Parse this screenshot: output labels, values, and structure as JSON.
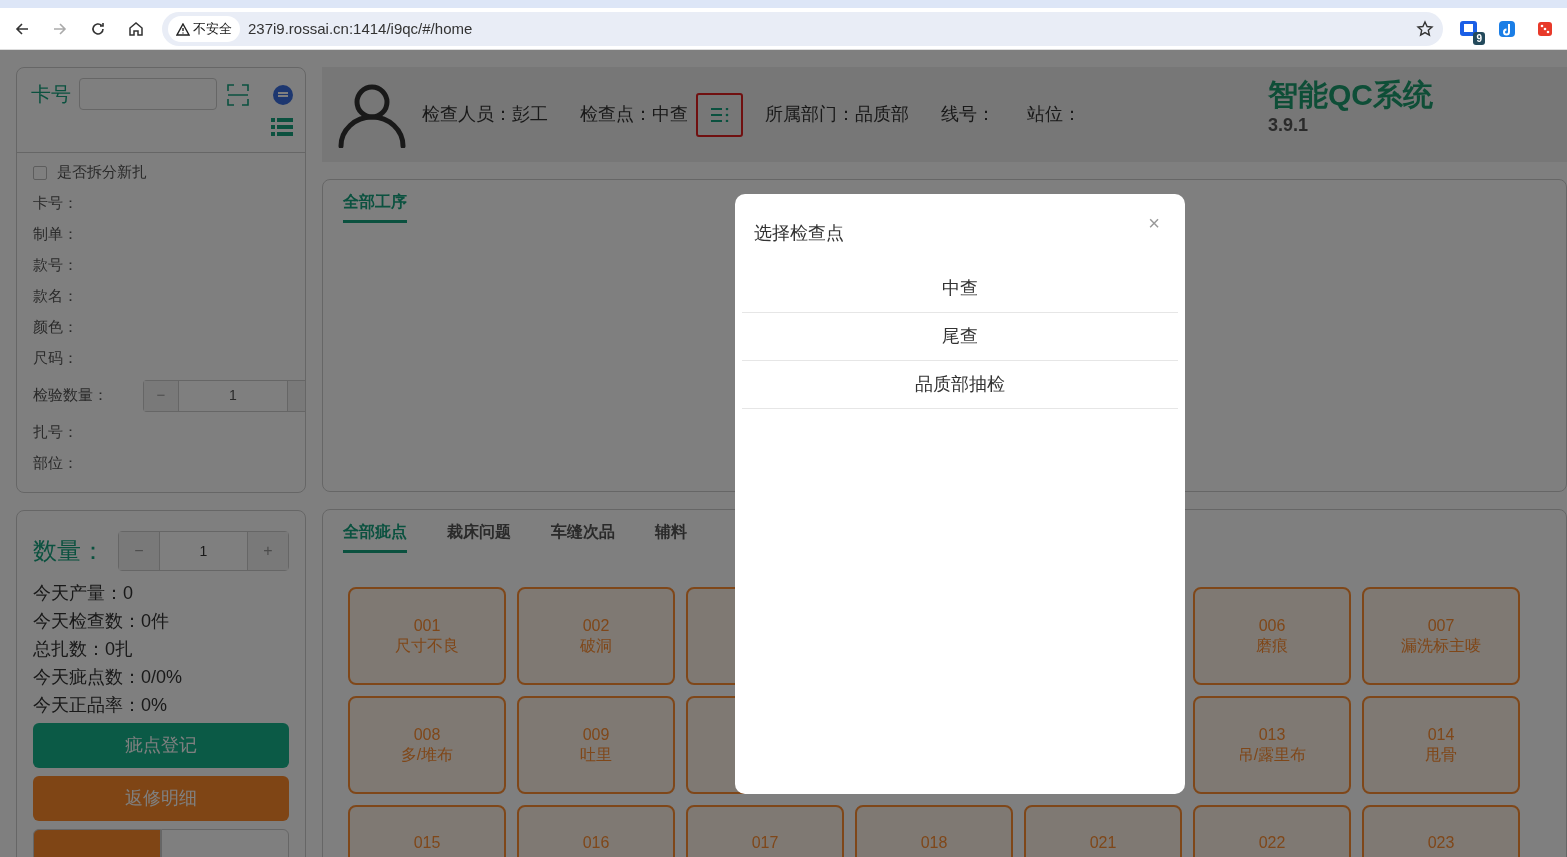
{
  "browser": {
    "security_label": "不安全",
    "url": "237i9.rossai.cn:1414/i9qc/#/home",
    "extension_badge": "9"
  },
  "card_panel": {
    "card_label": "卡号",
    "rows": [
      {
        "kind": "checkbox",
        "label": "是否拆分新扎",
        "checked": false
      },
      {
        "kind": "text",
        "label": "卡号："
      },
      {
        "kind": "text",
        "label": "制单："
      },
      {
        "kind": "text",
        "label": "款号："
      },
      {
        "kind": "text",
        "label": "款名："
      },
      {
        "kind": "text",
        "label": "颜色："
      },
      {
        "kind": "text",
        "label": "尺码："
      },
      {
        "kind": "stepper",
        "label": "检验数量：",
        "minus": "−",
        "value": "1"
      },
      {
        "kind": "text",
        "label": "扎号："
      },
      {
        "kind": "text",
        "label": "部位："
      }
    ]
  },
  "quantity_panel": {
    "label": "数量：",
    "minus": "−",
    "value": "1",
    "plus": "+",
    "stats": [
      "今天产量：0",
      "今天检查数：0件",
      "总扎数：0扎",
      "今天疵点数：0/0%",
      "今天正品率：0%"
    ],
    "buttons": [
      {
        "kind": "primary",
        "label": "疵点登记"
      },
      {
        "kind": "warning",
        "label": "返修明细"
      }
    ],
    "segments": [
      {
        "selected": true
      },
      {
        "selected": false
      }
    ]
  },
  "header": {
    "fields": [
      {
        "kind": "plain",
        "label": "检查人员：",
        "value": "彭工"
      },
      {
        "kind": "picker",
        "label": "检查点：",
        "value": "中查"
      },
      {
        "kind": "plain",
        "label": "所属部门：",
        "value": "品质部"
      },
      {
        "kind": "plain",
        "label": "线号："
      },
      {
        "kind": "plain",
        "label": "站位："
      }
    ],
    "title": "智能QC系统",
    "version": "3.9.1"
  },
  "process_tabs": [
    {
      "label": "全部工序",
      "selected": true
    }
  ],
  "defect_tabs": [
    {
      "label": "全部疵点",
      "selected": true
    },
    {
      "label": "裁床问题",
      "selected": false
    },
    {
      "label": "车缝次品",
      "selected": false
    },
    {
      "label": "辅料",
      "selected": false
    }
  ],
  "defects": [
    [
      {
        "kind": "defect",
        "code": "001",
        "name": "尺寸不良"
      },
      {
        "kind": "defect",
        "code": "002",
        "name": "破洞"
      },
      {
        "kind": "partial"
      },
      {
        "kind": "covered"
      },
      {
        "kind": "covered"
      },
      {
        "kind": "defect",
        "code": "006",
        "name": "磨痕"
      },
      {
        "kind": "defect",
        "code": "007",
        "name": "漏洗标主唛"
      }
    ],
    [
      {
        "kind": "defect",
        "code": "008",
        "name": "多/堆布"
      },
      {
        "kind": "defect",
        "code": "009",
        "name": "吐里"
      },
      {
        "kind": "partial"
      },
      {
        "kind": "covered"
      },
      {
        "kind": "covered"
      },
      {
        "kind": "defect",
        "code": "013",
        "name": "吊/露里布"
      },
      {
        "kind": "defect",
        "code": "014",
        "name": "甩骨"
      }
    ],
    [
      {
        "kind": "defect",
        "code": "015"
      },
      {
        "kind": "defect",
        "code": "016"
      },
      {
        "kind": "defect",
        "code": "017"
      },
      {
        "kind": "defect",
        "code": "018"
      },
      {
        "kind": "defect",
        "code": "021"
      },
      {
        "kind": "defect",
        "code": "022"
      },
      {
        "kind": "defect",
        "code": "023"
      }
    ]
  ],
  "modal": {
    "title": "选择检查点",
    "close": "×",
    "options": [
      {
        "label": "中查",
        "selected": false
      },
      {
        "label": "尾查",
        "selected": false
      },
      {
        "label": "品质部抽检",
        "selected": false
      }
    ]
  }
}
